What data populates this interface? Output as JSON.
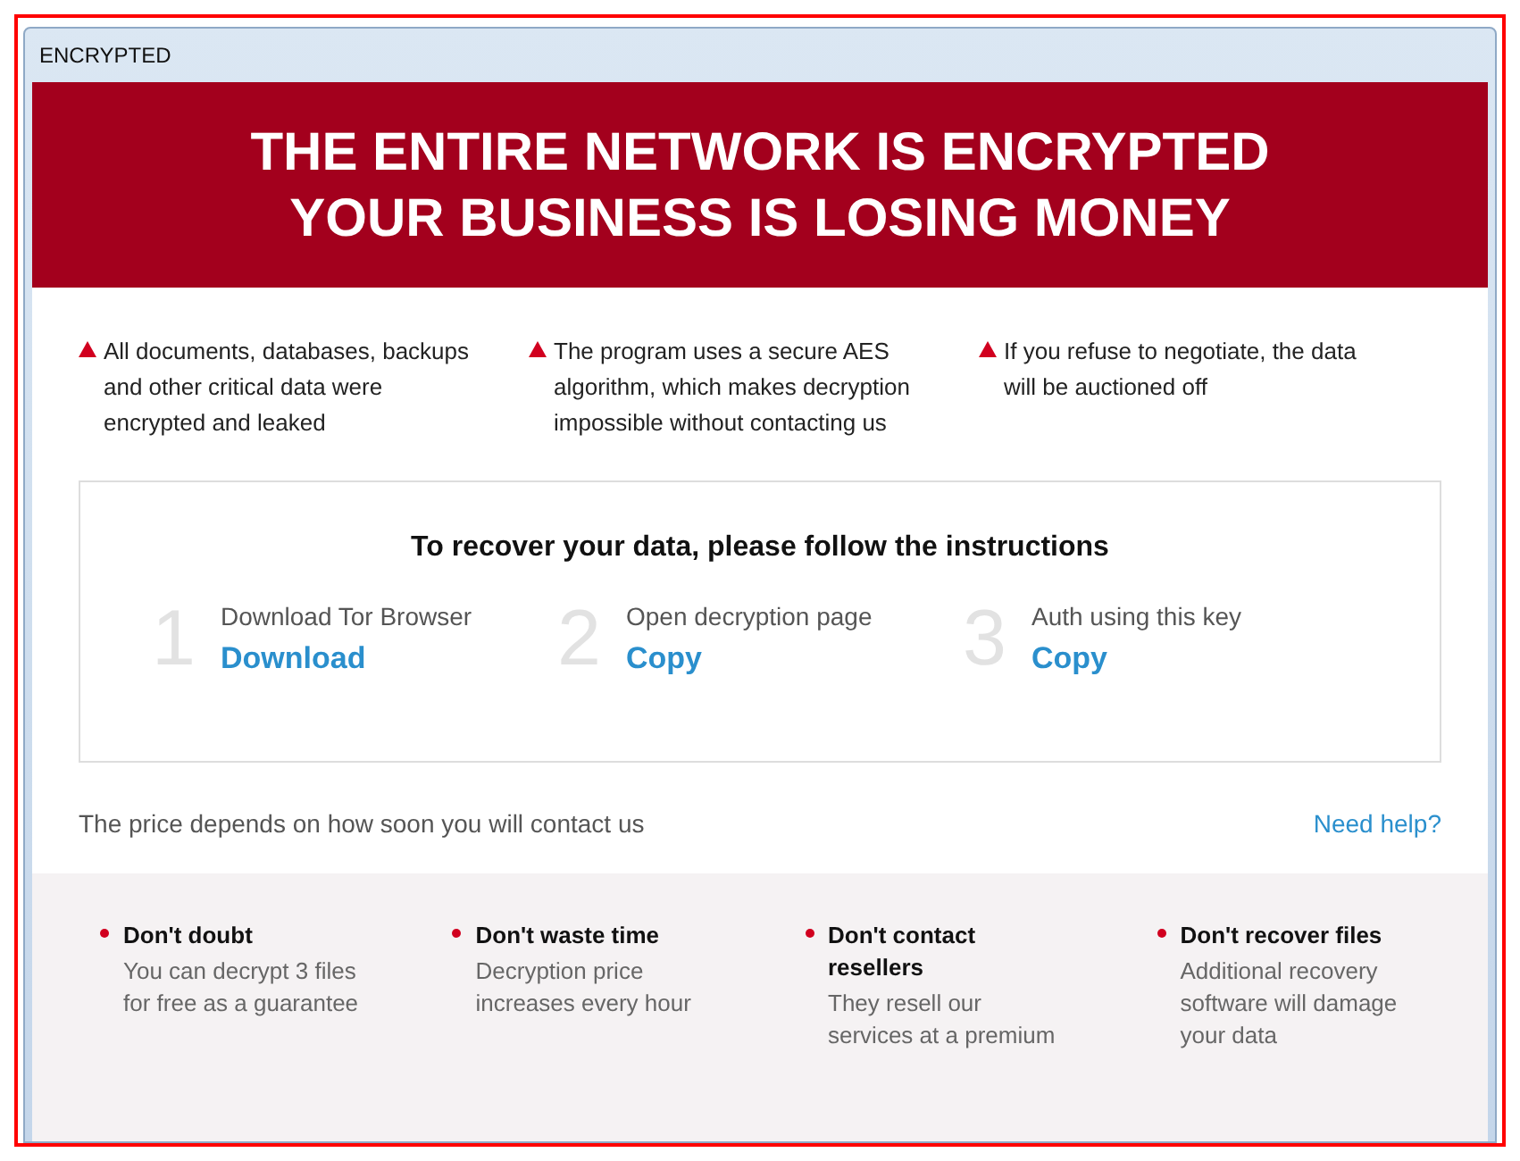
{
  "window": {
    "title": "ENCRYPTED"
  },
  "banner": {
    "lines": [
      "THE ENTIRE NETWORK IS ENCRYPTED",
      "YOUR BUSINESS IS LOSING MONEY"
    ]
  },
  "warnings": [
    "All documents, databases, backups and other critical data were encrypted and leaked",
    "The program uses a secure AES algorithm, which makes decryption impossible without contacting us",
    "If you refuse to negotiate, the data will be auctioned off"
  ],
  "instructions": {
    "title": "To recover your data, please follow the instructions",
    "steps": [
      {
        "number": "1",
        "label": "Download Tor Browser",
        "action": "Download"
      },
      {
        "number": "2",
        "label": "Open decryption page",
        "action": "Copy"
      },
      {
        "number": "3",
        "label": "Auth using this key",
        "action": "Copy"
      }
    ]
  },
  "price_note": "The price depends on how soon you will contact us",
  "help_link": "Need help?",
  "tips": [
    {
      "title": "Don't doubt",
      "text": "You can decrypt 3 files for free as a guarantee"
    },
    {
      "title": "Don't waste time",
      "text": "Decryption price increases every hour"
    },
    {
      "title": "Don't contact resellers",
      "text": "They resell our services at a premium"
    },
    {
      "title": "Don't recover files",
      "text": "Additional recovery software will damage your data"
    }
  ]
}
